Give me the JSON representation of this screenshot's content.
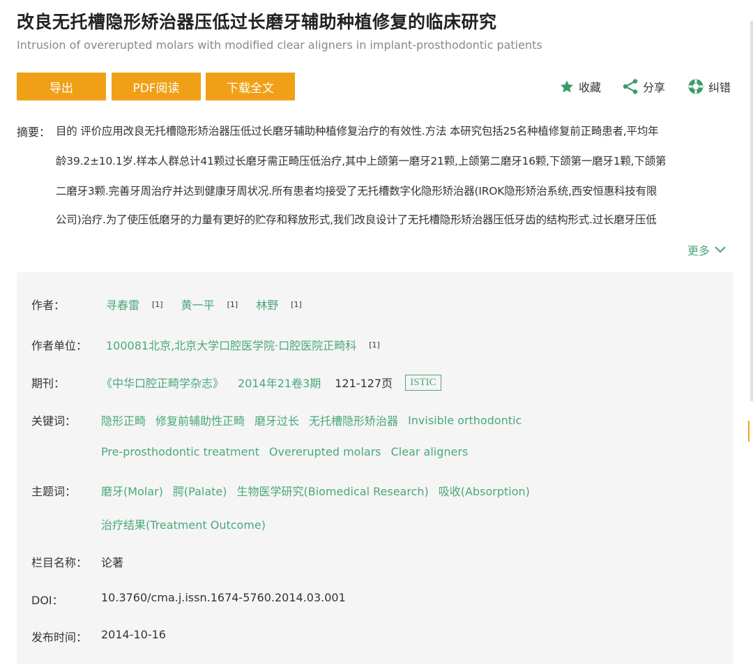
{
  "title_zh": "改良无托槽隐形矫治器压低过长磨牙辅助种植修复的临床研究",
  "title_en": "Intrusion of overerupted molars with modified clear aligners in implant-prosthodontic patients",
  "buttons": {
    "export": "导出",
    "pdf": "PDF阅读",
    "download": "下载全文"
  },
  "actions": {
    "favorite": "收藏",
    "share": "分享",
    "correct": "纠错"
  },
  "abstract": {
    "label": "摘要：",
    "lines": [
      "目的 评价应用改良无托槽隐形矫治器压低过长磨牙辅助种植修复治疗的有效性.方法 本研究包括25名种植修复前正畸患者,平均年",
      "龄39.2±10.1岁.样本人群总计41颗过长磨牙需正畸压低治疗,其中上颌第一磨牙21颗,上颌第二磨牙16颗,下颌第一磨牙1颗,下颌第",
      "二磨牙3颗.完善牙周治疗并达到健康牙周状况.所有患者均接受了无托槽数字化隐形矫治器(IROK隐形矫治系统,西安恒惠科技有限",
      "公司)治疗.为了使压低磨牙的力量有更好的贮存和释放形式,我们改良设计了无托槽隐形矫治器压低牙齿的结构形式.过长磨牙压低"
    ],
    "more": "更多"
  },
  "info": {
    "authors_label": "作者：",
    "authors": [
      {
        "name": "寻春雷",
        "ref": "[1]"
      },
      {
        "name": "黄一平",
        "ref": "[1]"
      },
      {
        "name": "林野",
        "ref": "[1]"
      }
    ],
    "unit_label": "作者单位：",
    "unit": "100081北京,北京大学口腔医学院·口腔医院正畸科",
    "unit_ref": "[1]",
    "journal_label": "期刊：",
    "journal": "《中华口腔正畸学杂志》",
    "issue": "2014年21卷3期",
    "pages": "121-127页",
    "index": "ISTIC",
    "keywords_label": "关键词：",
    "keywords": [
      "隐形正畸",
      "修复前辅助性正畸",
      "磨牙过长",
      "无托槽隐形矫治器",
      "Invisible orthodontic",
      "Pre-prosthodontic treatment",
      "Overerupted molars",
      "Clear aligners"
    ],
    "subjects_label": "主题词：",
    "subjects": [
      "磨牙(Molar)",
      "腭(Palate)",
      "生物医学研究(Biomedical Research)",
      "吸收(Absorption)",
      "治疗结果(Treatment Outcome)"
    ],
    "column_label": "栏目名称：",
    "column": "论著",
    "doi_label": "DOI：",
    "doi": "10.3760/cma.j.issn.1674-5760.2014.03.001",
    "date_label": "发布时间：",
    "date": "2014-10-16"
  },
  "colors": {
    "accent": "#f0a016",
    "link": "#4aa87a",
    "panel": "#f5f5f5"
  }
}
